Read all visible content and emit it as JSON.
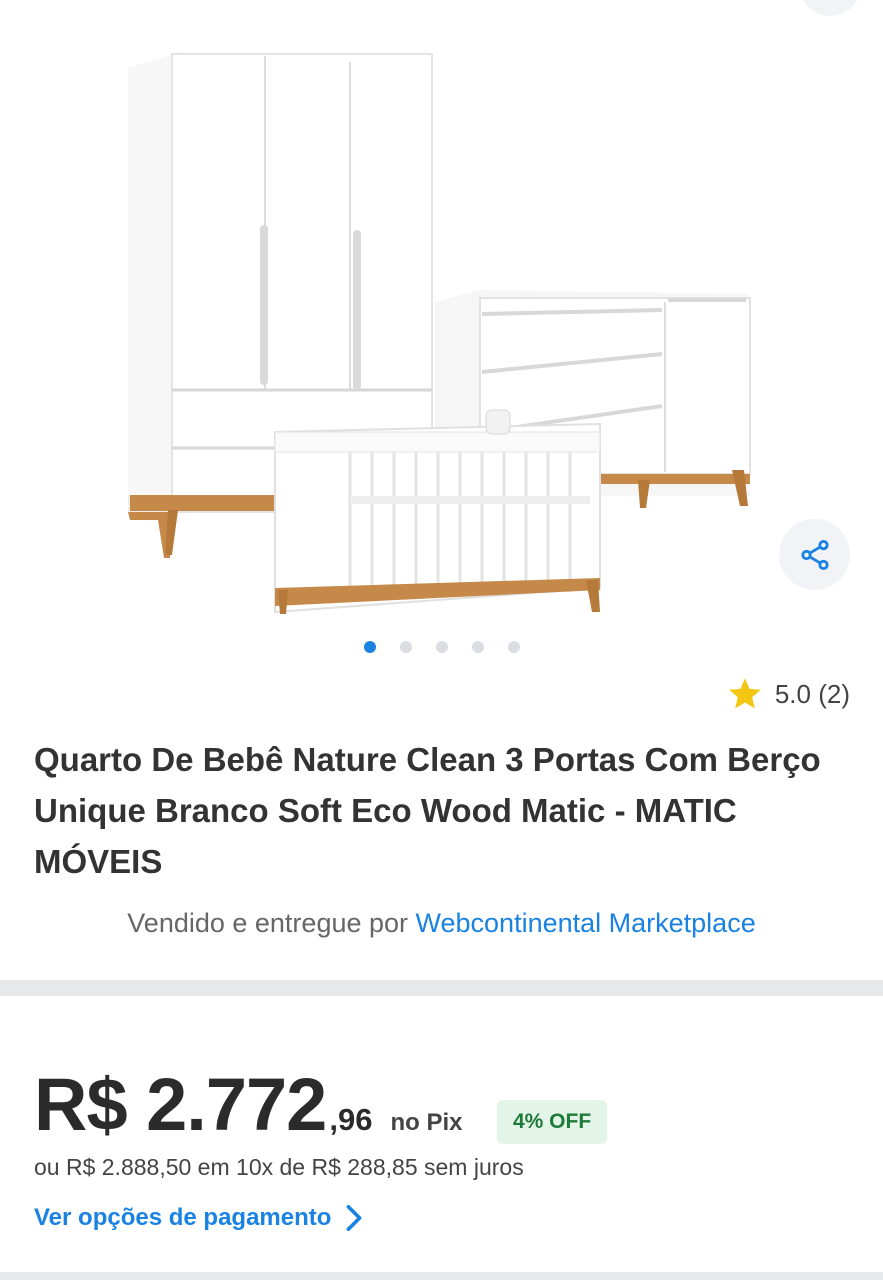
{
  "gallery": {
    "image_alt": "product-photo",
    "dots_total": 5,
    "active_index": 0
  },
  "icons": {
    "share": "share-icon",
    "star": "star-icon",
    "chevron": "chevron-right-icon"
  },
  "rating": {
    "text": "5.0 (2)",
    "value": 5.0,
    "count": 2
  },
  "product": {
    "title": "Quarto De Bebê Nature Clean 3 Portas Com Berço Unique Branco Soft Eco Wood Matic - MATIC MÓVEIS"
  },
  "seller": {
    "prefix": "Vendido e entregue por ",
    "name": "Webcontinental Marketplace"
  },
  "price": {
    "main": "R$ 2.772",
    "cents": ",96",
    "method": "no Pix",
    "discount": "4% OFF",
    "installments": "ou R$ 2.888,50 em 10x de R$ 288,85 sem juros",
    "payment_link": "Ver opções de pagamento"
  },
  "colors": {
    "accent": "#1a82e2",
    "star": "#f3c614",
    "discount_bg": "#e3f5e8",
    "discount_text": "#1f7a3a"
  }
}
